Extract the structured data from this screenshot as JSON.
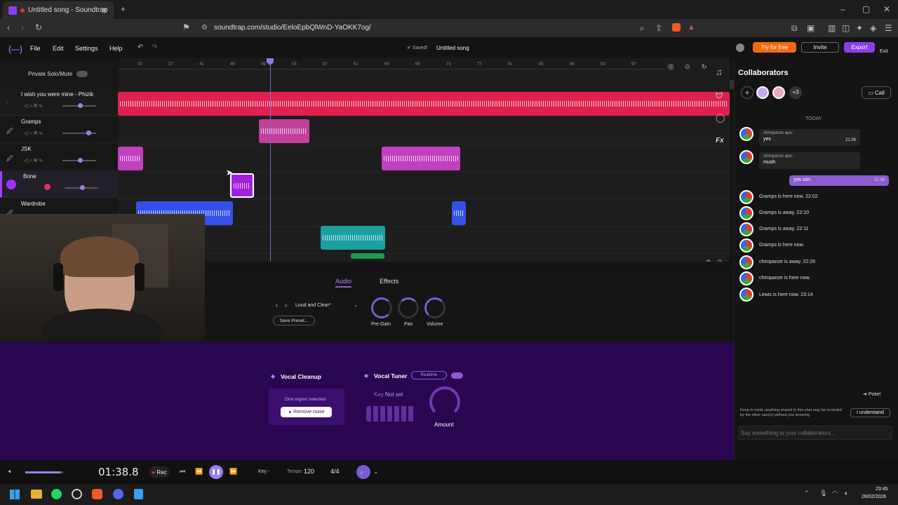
{
  "browser": {
    "tab_title": "Untitled song - Soundtrap",
    "url": "soundtrap.com/studio/EeloEpbQlWnD-YaOKK7og/"
  },
  "menu": {
    "file": "File",
    "edit": "Edit",
    "settings": "Settings",
    "help": "Help",
    "saved": "Saved!",
    "song_title": "Untitled song",
    "try_free": "Try for free",
    "invite": "Invite",
    "export": "Export",
    "exit": "Exit"
  },
  "tracks_header": {
    "private": "Private Solo/Mute"
  },
  "tracks": [
    {
      "name": "I wish you were mine - Phizik"
    },
    {
      "name": "Gramps"
    },
    {
      "name": "JSK"
    },
    {
      "name": "Bone"
    },
    {
      "name": "Wardrobe"
    }
  ],
  "ruler": [
    "33",
    "37",
    "41",
    "45",
    "49",
    "53",
    "57",
    "61",
    "65",
    "69",
    "73",
    "77",
    "81",
    "85",
    "89",
    "93",
    "97"
  ],
  "collab": {
    "title": "Collaborators",
    "more": "+3",
    "call": "Call",
    "today": "TODAY",
    "messages": [
      {
        "user": "chimpanze ape:",
        "text": "yes",
        "time": "21:36"
      },
      {
        "user": "chimpanze ape:",
        "text": "mush",
        "time": ""
      }
    ],
    "own": {
      "text": "yes son",
      "time": "21:38"
    },
    "events": [
      "Gramps is here now. 22:02",
      "Gramps is away. 22:10",
      "Gramps is away. 22:11",
      "Gramps is here now.",
      "chimpanze is away. 22:26",
      "chimpanze is here now.",
      "Lewis is here now. 23:14"
    ],
    "poke": "Poke!",
    "notice": "Keep in mind, anything shared in this chat may be recorded by the other user(s) without you knowing.",
    "understand": "I understand",
    "placeholder": "Say something to your collaborators..."
  },
  "editor": {
    "tab_audio": "Audio",
    "tab_effects": "Effects",
    "preset": "Loud and Clear*",
    "save_preset": "Save Preset...",
    "knobs": [
      "Pre-Gain",
      "Pan",
      "Volume"
    ]
  },
  "plugins": {
    "cleanup_title": "Vocal Cleanup",
    "cleanup_status": "One region selected",
    "remove_noise": "Remove noise",
    "tuner_title": "Vocal Tuner",
    "tuner_mode": "Realtime",
    "key_label": "Key",
    "key_value": "Not set",
    "amount": "Amount"
  },
  "transport": {
    "time": "01:38.8",
    "rec": "Rec",
    "key": "Key -",
    "tempo_label": "Tempo",
    "tempo": "120",
    "signature": "4/4"
  },
  "taskbar": {
    "time": "23:45",
    "date": "26/02/2026"
  }
}
